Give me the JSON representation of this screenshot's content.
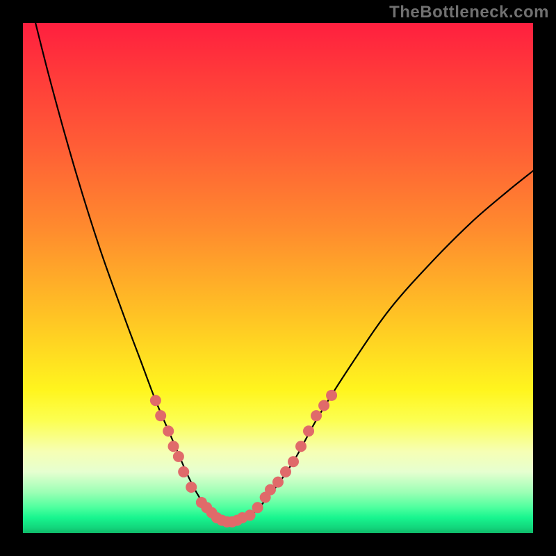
{
  "watermark": "TheBottleneck.com",
  "chart_data": {
    "type": "line",
    "title": "",
    "xlabel": "",
    "ylabel": "",
    "xlim": [
      0,
      100
    ],
    "ylim": [
      0,
      100
    ],
    "gradient_stops": [
      {
        "pos": 0,
        "color": "#ff1f3f"
      },
      {
        "pos": 10,
        "color": "#ff3a3a"
      },
      {
        "pos": 24,
        "color": "#ff5d36"
      },
      {
        "pos": 40,
        "color": "#ff8a2e"
      },
      {
        "pos": 58,
        "color": "#ffc524"
      },
      {
        "pos": 72,
        "color": "#fff51e"
      },
      {
        "pos": 78,
        "color": "#fcff52"
      },
      {
        "pos": 84,
        "color": "#f6ffb4"
      },
      {
        "pos": 88,
        "color": "#e6ffd0"
      },
      {
        "pos": 92,
        "color": "#9cffb5"
      },
      {
        "pos": 95,
        "color": "#4dff9e"
      },
      {
        "pos": 97,
        "color": "#18f58f"
      },
      {
        "pos": 99,
        "color": "#12d47b"
      },
      {
        "pos": 100,
        "color": "#0fb968"
      }
    ],
    "series": [
      {
        "name": "curve",
        "color": "#000000",
        "x": [
          0,
          5,
          10,
          15,
          20,
          23,
          26,
          29,
          32,
          34,
          36,
          38,
          40,
          44,
          48,
          53,
          58,
          65,
          72,
          80,
          88,
          95,
          100
        ],
        "y": [
          110,
          90,
          72,
          56,
          42,
          34,
          26,
          19,
          12,
          8,
          5,
          3,
          2,
          3,
          7,
          14,
          23,
          34,
          44,
          53,
          61,
          67,
          71
        ]
      }
    ],
    "highlight_dots": {
      "color": "#e06a6a",
      "radius": 8,
      "points": [
        {
          "x": 26,
          "y": 26
        },
        {
          "x": 27,
          "y": 23
        },
        {
          "x": 28.5,
          "y": 20
        },
        {
          "x": 29.5,
          "y": 17
        },
        {
          "x": 30.5,
          "y": 15
        },
        {
          "x": 31.5,
          "y": 12
        },
        {
          "x": 33,
          "y": 9
        },
        {
          "x": 35,
          "y": 6
        },
        {
          "x": 36,
          "y": 5
        },
        {
          "x": 37,
          "y": 4
        },
        {
          "x": 38,
          "y": 3
        },
        {
          "x": 39,
          "y": 2.5
        },
        {
          "x": 40,
          "y": 2.2
        },
        {
          "x": 41,
          "y": 2.2
        },
        {
          "x": 42,
          "y": 2.5
        },
        {
          "x": 43,
          "y": 3
        },
        {
          "x": 44.5,
          "y": 3.5
        },
        {
          "x": 46,
          "y": 5
        },
        {
          "x": 47.5,
          "y": 7
        },
        {
          "x": 48.5,
          "y": 8.5
        },
        {
          "x": 50,
          "y": 10
        },
        {
          "x": 51.5,
          "y": 12
        },
        {
          "x": 53,
          "y": 14
        },
        {
          "x": 54.5,
          "y": 17
        },
        {
          "x": 56,
          "y": 20
        },
        {
          "x": 57.5,
          "y": 23
        },
        {
          "x": 59,
          "y": 25
        },
        {
          "x": 60.5,
          "y": 27
        }
      ]
    }
  }
}
